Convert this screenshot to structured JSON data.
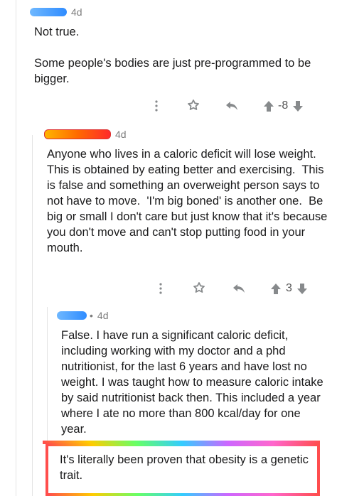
{
  "comments": [
    {
      "time": "4d",
      "username_color": "#3aa0ff",
      "body": "Not true.\n\nSome people's bodies are just pre-programmed to be bigger.",
      "score": "-8"
    },
    {
      "time": "4d",
      "username_color": "#ff3b30",
      "body": "Anyone who lives in a caloric deficit will lose weight.  This is obtained by eating better and exercising.  This is false and something an overweight person says to not have to move.  'I'm big boned' is another one.  Be big or small I don't care but just know that it's because you don't move and can't stop putting food in your mouth.",
      "score": "3"
    },
    {
      "time": "4d",
      "username_color": "#3aa0ff",
      "separator": "•",
      "body": "False. I have run a significant caloric deficit, including working with my doctor and a phd nutritionist, for the last 6 years and have lost no weight. I was taught how to measure caloric intake by said nutritionist back then. This included a year where I ate no more than 800 kcal/day for one year.",
      "quote": "It's literally been proven that obesity is a genetic trait."
    }
  ],
  "icons": [
    "more-options-icon",
    "award-icon",
    "reply-icon",
    "upvote-icon",
    "downvote-icon"
  ]
}
